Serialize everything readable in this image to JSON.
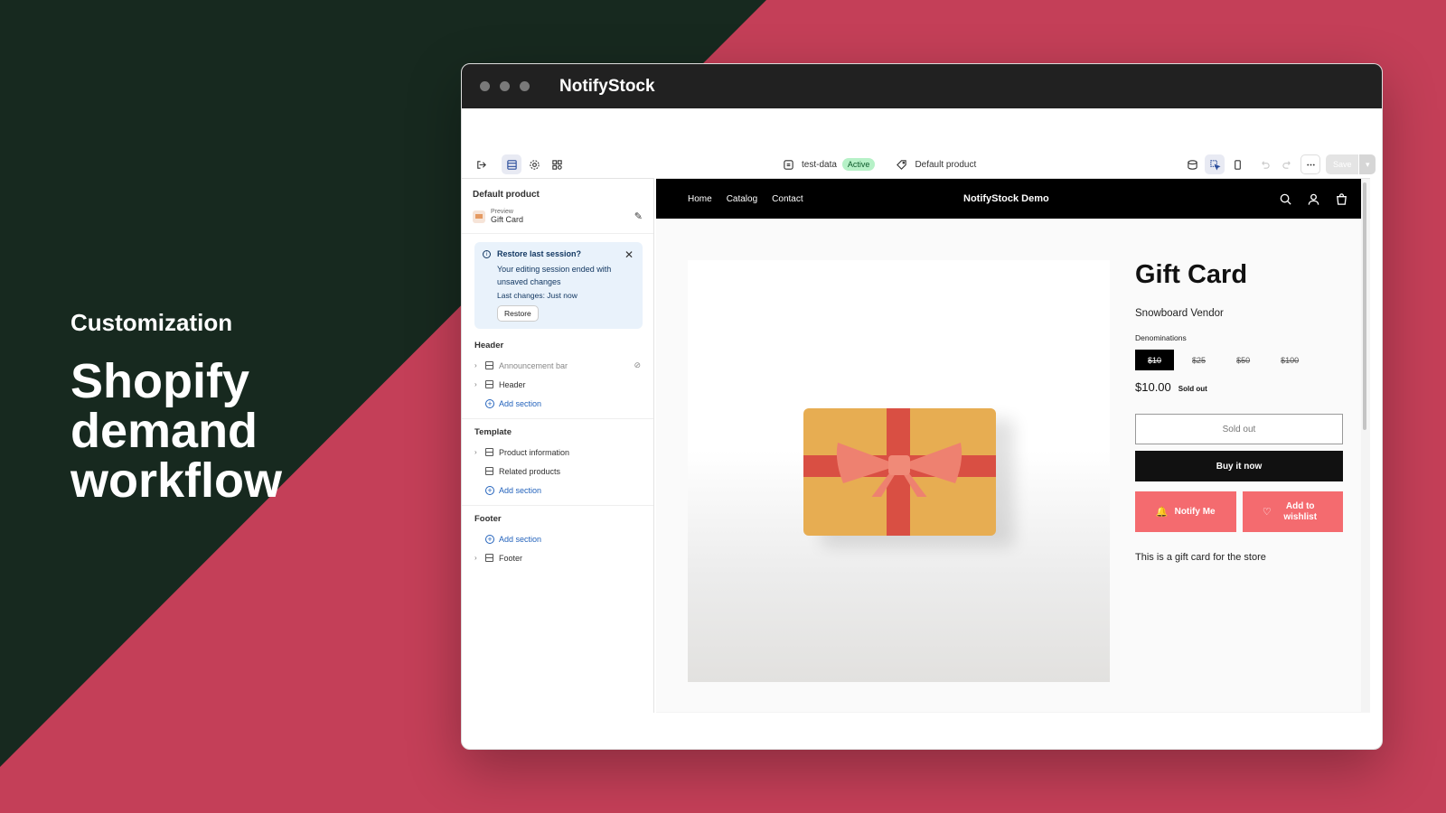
{
  "hero": {
    "kicker": "Customization",
    "title": "Shopify demand workflow"
  },
  "window": {
    "app_title": "NotifyStock"
  },
  "toolbar": {
    "theme_name": "test-data",
    "theme_status": "Active",
    "template": "Default product",
    "save_label": "Save"
  },
  "sidebar": {
    "title": "Default product",
    "preview_label": "Preview",
    "preview_value": "Gift Card",
    "notice": {
      "title": "Restore last session?",
      "body": "Your editing session ended with unsaved changes",
      "last": "Last changes: Just now",
      "button": "Restore"
    },
    "header": {
      "title": "Header",
      "items": [
        "Announcement bar",
        "Header"
      ],
      "add": "Add section"
    },
    "template": {
      "title": "Template",
      "items": [
        "Product information",
        "Related products"
      ],
      "add": "Add section"
    },
    "footer": {
      "title": "Footer",
      "add": "Add section",
      "items": [
        "Footer"
      ]
    }
  },
  "store": {
    "nav": [
      "Home",
      "Catalog",
      "Contact"
    ],
    "brand": "NotifyStock Demo",
    "product": {
      "title": "Gift Card",
      "vendor": "Snowboard Vendor",
      "denominations_label": "Denominations",
      "denominations": [
        "$10",
        "$25",
        "$50",
        "$100"
      ],
      "price": "$10.00",
      "status": "Sold out",
      "sold_out_button": "Sold out",
      "buy_button": "Buy it now",
      "notify_button": "Notify Me",
      "wishlist_button": "Add to wishlist",
      "description": "This is a gift card for the store"
    }
  },
  "colors": {
    "accent_red": "#f46b6f",
    "background_pink": "#c43f58",
    "background_dark": "#17291f"
  }
}
